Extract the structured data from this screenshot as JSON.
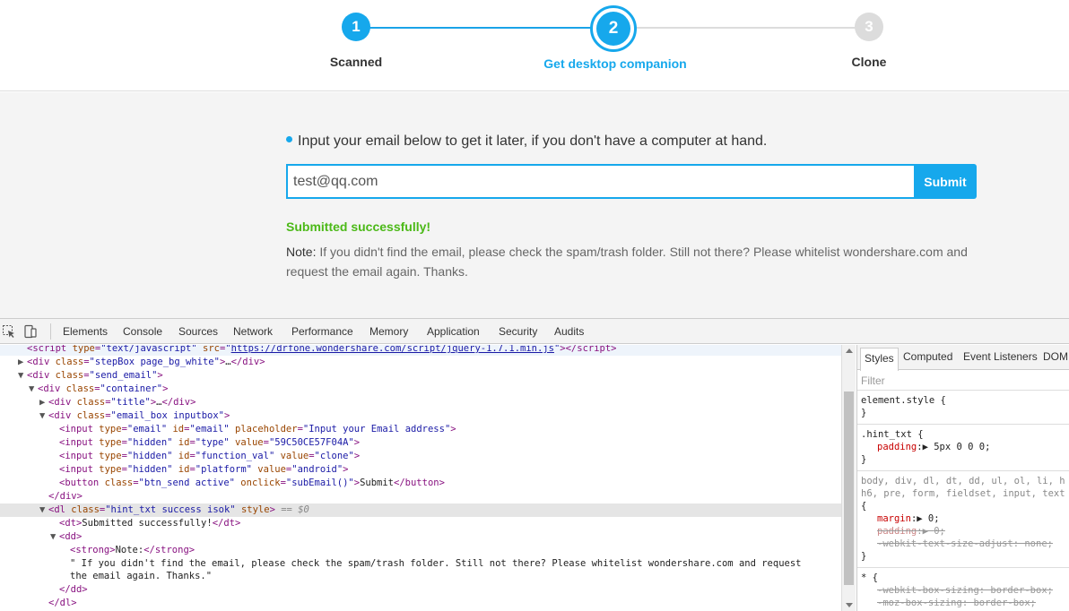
{
  "stepper": {
    "steps": [
      {
        "number": "1",
        "label": "Scanned"
      },
      {
        "number": "2",
        "label": "Get desktop companion"
      },
      {
        "number": "3",
        "label": "Clone"
      }
    ],
    "accent_color": "#16a8ec"
  },
  "email_section": {
    "title": "Input your email below to get it later, if you don't have a computer at hand.",
    "email_value": "test@qq.com",
    "submit_label": "Submit",
    "success_text": "Submitted successfully!",
    "note_label": "Note:",
    "note_text": " If you didn't find the email, please check the spam/trash folder. Still not there? Please whitelist wondershare.com and request the email again. Thanks.",
    "success_color": "#4bb917"
  },
  "devtools": {
    "tabs": [
      "Elements",
      "Console",
      "Sources",
      "Network",
      "Performance",
      "Memory",
      "Application",
      "Security",
      "Audits"
    ],
    "dom": {
      "script_src": "https://drfone.wondershare.com/script/jquery-1.7.1.min.js",
      "l1_tag": "script",
      "l1_type": "\"text/javascript\"",
      "l2_class": "\"stepBox page_bg_white\"",
      "l3_class": "\"send_email\"",
      "l4_class": "\"container\"",
      "l5_class": "\"title\"",
      "l6_class": "\"email_box inputbox\"",
      "input1": {
        "type": "\"email\"",
        "id": "\"email\"",
        "placeholder": "\"Input your Email address\""
      },
      "input2": {
        "type": "\"hidden\"",
        "id": "\"type\"",
        "value": "\"59C50CE57F04A\""
      },
      "input3": {
        "type": "\"hidden\"",
        "id": "\"function_val\"",
        "value": "\"clone\""
      },
      "input4": {
        "type": "\"hidden\"",
        "id": "\"platform\"",
        "value": "\"android\""
      },
      "button": {
        "class": "\"btn_send active\"",
        "onclick": "\"subEmail()\"",
        "text": "Submit"
      },
      "dl_class": "\"hint_txt success isok\"",
      "dl_eq": "== $0",
      "dt_text": "Submitted successfully!",
      "strong_text": "Note:",
      "dd_text_1": "\" If you didn't find the email, please check the spam/trash folder. Still not there? Please whitelist wondershare.com and request",
      "dd_text_2": "the email again. Thanks.\""
    },
    "styles": {
      "tabs": [
        "Styles",
        "Computed",
        "Event Listeners",
        "DOM"
      ],
      "filter_placeholder": "Filter",
      "element_style": "element.style {",
      "hint_selector": ".hint_txt {",
      "hint_prop": "padding",
      "hint_val": "5px 0 0 0;",
      "reset_selector_1": "body, div, dl, dt, dd, ul, ol, li, h",
      "reset_selector_2": "h6, pre, form, fieldset, input, text",
      "margin_prop": "margin",
      "margin_val": "0;",
      "padding_prop": "padding",
      "padding_val": "0;",
      "webkit_text": "-webkit-text-size-adjust: none;",
      "universal": "* {",
      "webkit_box": "-webkit-box-sizing: border-box;",
      "moz_box": "-moz-box-sizing: border-box;"
    }
  }
}
